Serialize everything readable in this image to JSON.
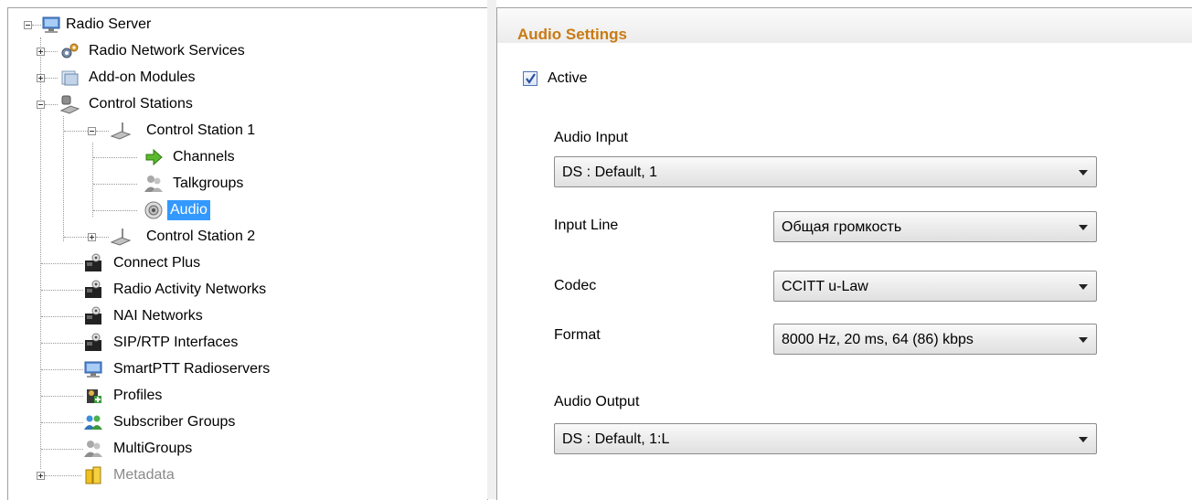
{
  "tree": {
    "root": "Radio Server",
    "items": [
      {
        "label": "Radio Network Services",
        "icon": "radio-network-services-icon"
      },
      {
        "label": "Add-on Modules",
        "icon": "add-on-modules-icon"
      },
      {
        "label": "Control Stations",
        "icon": "control-stations-icon"
      },
      {
        "label": "Control Station 1",
        "icon": "control-station-icon"
      },
      {
        "label": "Channels",
        "icon": "channels-arrow-icon"
      },
      {
        "label": "Talkgroups",
        "icon": "talkgroups-icon"
      },
      {
        "label": "Audio",
        "icon": "audio-speaker-icon"
      },
      {
        "label": "Control Station 2",
        "icon": "control-station-icon"
      },
      {
        "label": "Connect Plus",
        "icon": "radio-network-icon"
      },
      {
        "label": "Radio Activity Networks",
        "icon": "radio-network-icon"
      },
      {
        "label": "NAI Networks",
        "icon": "radio-network-icon"
      },
      {
        "label": "SIP/RTP Interfaces",
        "icon": "radio-network-icon"
      },
      {
        "label": "SmartPTT Radioservers",
        "icon": "computer-icon"
      },
      {
        "label": "Profiles",
        "icon": "profiles-icon"
      },
      {
        "label": "Subscriber Groups",
        "icon": "subscriber-groups-icon"
      },
      {
        "label": "MultiGroups",
        "icon": "multigroups-icon"
      },
      {
        "label": "Metadata",
        "icon": "metadata-icon"
      }
    ],
    "selected": "Audio"
  },
  "settings": {
    "title": "Audio Settings",
    "active_label": "Active",
    "active_checked": true,
    "audio_input_label": "Audio Input",
    "audio_input_value": "DS : Default, 1",
    "input_line_label": "Input Line",
    "input_line_value": "Общая громкость",
    "codec_label": "Codec",
    "codec_value": "CCITT u-Law",
    "format_label": "Format",
    "format_value": "8000 Hz, 20 ms, 64 (86) kbps",
    "audio_output_label": "Audio Output",
    "audio_output_value": "DS : Default, 1:L"
  },
  "colors": {
    "header_text": "#c97a12",
    "selection": "#3399ff"
  }
}
